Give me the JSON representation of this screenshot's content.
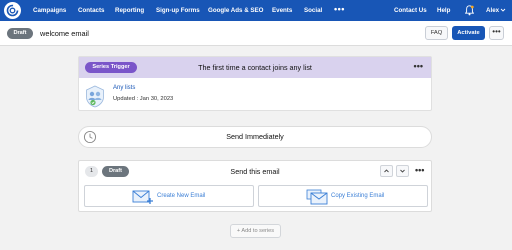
{
  "nav": {
    "items": [
      "Campaigns",
      "Contacts",
      "Reporting",
      "Sign-up Forms",
      "Google Ads & SEO",
      "Events",
      "Social"
    ],
    "more": "•••",
    "contact_us": "Contact Us",
    "help": "Help",
    "user": "Alex",
    "icons": [
      "logo-icon",
      "bell-icon",
      "chevron-down-icon"
    ]
  },
  "header": {
    "status": "Draft",
    "title": "welcome email",
    "faq_label": "FAQ",
    "activate_label": "Activate",
    "more_label": "•••"
  },
  "trigger": {
    "badge": "Series Trigger",
    "description": "The first time a contact joins any list",
    "more_label": "•••",
    "list_name": "Any lists",
    "updated": "Updated : Jan 30, 2023"
  },
  "timing": {
    "label": "Send Immediately"
  },
  "email_step": {
    "number": "1",
    "status": "Draft",
    "title": "Send this email",
    "more_label": "•••",
    "create_label": "Create New Email",
    "copy_label": "Copy Existing Email"
  },
  "add_series_label": "+ Add to series",
  "colors": {
    "nav_bg": "#1856b6",
    "trigger_header_bg": "#d9d2ee",
    "trigger_badge": "#7a55c9",
    "draft_badge": "#6c757d",
    "link": "#3b7fd6"
  }
}
